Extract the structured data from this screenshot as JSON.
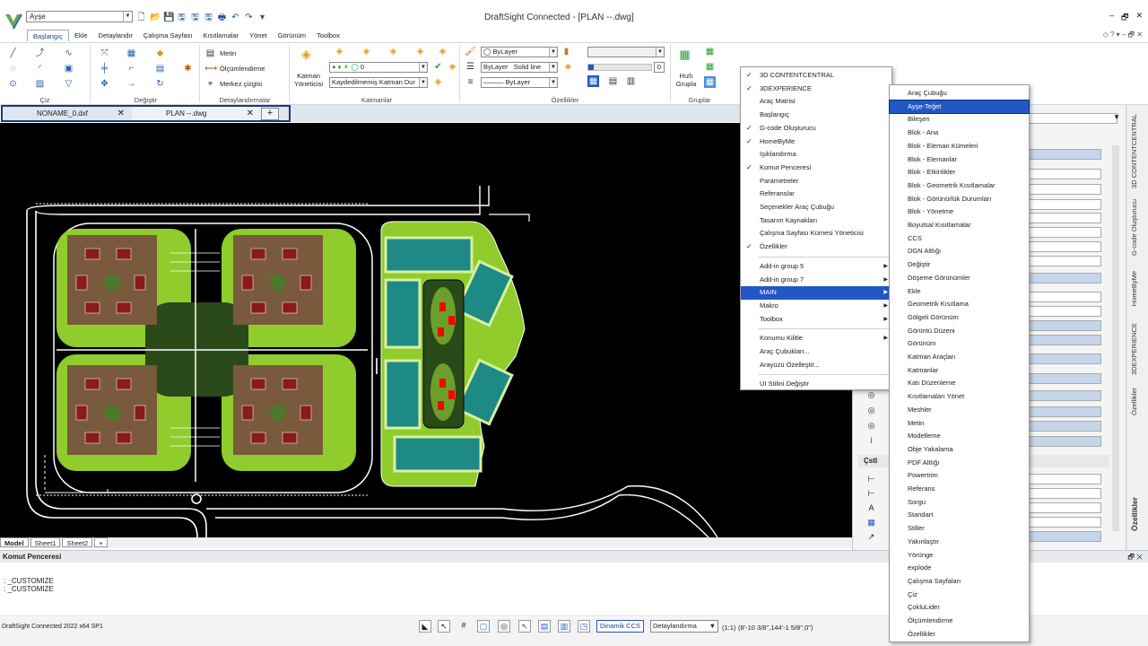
{
  "app": {
    "title": "DraftSight Connected - [PLAN --.dwg]",
    "workspace": "Ayşe",
    "window_controls": [
      "–",
      "🗗",
      "✕"
    ],
    "ribbon_right": "◇  ?  ▾  –  🗗  ✕"
  },
  "ribbon_tabs": [
    "Başlangıç",
    "Ekle",
    "Detaylandır",
    "Çalışma Sayfası",
    "Kısıtlamalar",
    "Yönet",
    "Görünüm",
    "Toolbox"
  ],
  "ribbon": {
    "groups": [
      "Çiz",
      "Değiştir",
      "Detaylandırmalar",
      "Katmanlar",
      "Özellikler",
      "Gruplar"
    ],
    "detail": {
      "text": "Metin",
      "dim": "Ölçümlendirme",
      "center": "Merkez çizgisi"
    },
    "layers": {
      "manager_label": "Katman Yöneticisi",
      "current_layer": "0",
      "saved_state": "Kaydedilmemiş Katman Dur"
    },
    "props": {
      "color": "ByLayer",
      "linetype_layer": "ByLayer",
      "linetype": "Solid line",
      "lineweight": "ByLayer",
      "transparency": "0"
    },
    "groups_btn": "Hızlı Grupla"
  },
  "doc_tabs": [
    {
      "label": "NONAME_0.dxf"
    },
    {
      "label": "PLAN --.dwg"
    }
  ],
  "sheet_tabs": [
    "Model",
    "Sheet1",
    "Sheet2",
    "+"
  ],
  "command": {
    "title": "Komut Penceresi",
    "lines": [
      ": _CUSTOMIZE",
      ": _CUSTOMIZE",
      ":"
    ]
  },
  "status": {
    "product": "DraftSight Connected 2022  x64 SP1",
    "dynamic_ccs": "Dinamik CCS",
    "annotation": "Detaylandırma",
    "scale": "(1:1)",
    "coords": "(8'-10 3/8\",144'-1 5/8\",0\")"
  },
  "props_panel": {
    "section_label": "Çstl",
    "vertical_tab": "Özellikler"
  },
  "side_tabs": [
    "3D CONTENTCENTRAL",
    "G-code Oluşturucu",
    "HomeByMe",
    "3DEXPERIENCE",
    "Özellikler"
  ],
  "menu1": {
    "items": [
      {
        "label": "3D CONTENTCENTRAL",
        "checked": true
      },
      {
        "label": "3DEXPERIENCE",
        "checked": true
      },
      {
        "label": "Araç Matrisi",
        "checked": false
      },
      {
        "label": "Başlangıç",
        "checked": false
      },
      {
        "label": "G-code Oluşturucu",
        "checked": true
      },
      {
        "label": "HomeByMe",
        "checked": true
      },
      {
        "label": "Işıklandırma",
        "checked": false
      },
      {
        "label": "Komut Penceresi",
        "checked": true
      },
      {
        "label": "Parametreler",
        "checked": false
      },
      {
        "label": "Referanslar",
        "checked": false
      },
      {
        "label": "Seçenekler Araç Çubuğu",
        "checked": false
      },
      {
        "label": "Tasarım Kaynakları",
        "checked": false
      },
      {
        "label": "Çalışma Sayfası Kümesi Yöneticisi",
        "checked": false
      },
      {
        "label": "Özellikler",
        "checked": true
      }
    ],
    "submenus": [
      {
        "label": "Add-in group 5"
      },
      {
        "label": "Add-in group 7"
      },
      {
        "label": "MAIN"
      },
      {
        "label": "Makro"
      },
      {
        "label": "Toolbox"
      }
    ],
    "bottom": [
      {
        "label": "Konumu Kilitle",
        "arrow": true
      },
      {
        "label": "Araç Çubukları...",
        "arrow": false
      },
      {
        "label": "Arayüzü Özelleştir...",
        "arrow": false
      }
    ],
    "last": "UI Stilini Değiştir"
  },
  "menu2": {
    "items": [
      "Araç Çubuğu",
      "Ayşe-Teğet",
      "Bileşen",
      "Blok - Ana",
      "Blok - Eleman Kümeleri",
      "Blok - Elemanlar",
      "Blok - Etkinlikler",
      "Blok - Geometrik Kısıtlamalar",
      "Blok - Görünürlük Durumları",
      "Blok - Yönetme",
      "Boyutsal Kısıtlamalar",
      "CCS",
      "DGN Altlığı",
      "Değiştir",
      "Döşeme Görünümler",
      "Ekle",
      "Geometrik Kısıtlama",
      "Gölgeli Görünüm",
      "Görüntü Düzeni",
      "Görünüm",
      "Katman Araçları",
      "Katmanlar",
      "Katı Düzenleme",
      "Kısıtlamaları Yönet",
      "Meshler",
      "Metin",
      "Modelleme",
      "Obje Yakalama",
      "PDF Altlığı",
      "Powertrim",
      "Referans",
      "Sorgu",
      "Standart",
      "Stiller",
      "Yakınlaştır",
      "Yörünge",
      "explode",
      "Çalışma Sayfaları",
      "Çiz",
      "ÇokluLider",
      "Ölçümlendirme",
      "Özellikler"
    ]
  },
  "colors": {
    "accent": "#2257c5",
    "canvas": "#000000",
    "green": "#8fcc2c",
    "teal": "#1e8a85"
  }
}
